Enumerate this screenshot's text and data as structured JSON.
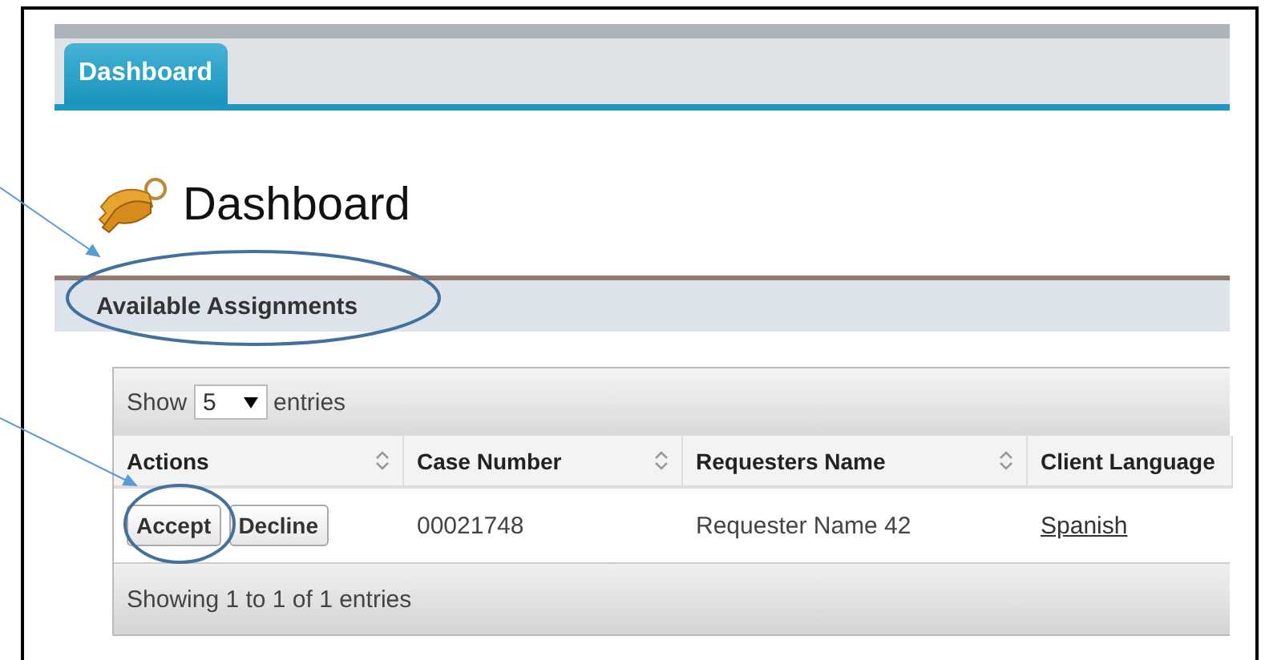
{
  "tabs": [
    {
      "label": "Dashboard",
      "selected": true
    }
  ],
  "page_title": "Dashboard",
  "section_title": "Available Assignments",
  "table": {
    "length_label_before": "Show",
    "length_value": "5",
    "length_label_after": "entries",
    "columns": [
      {
        "label": "Actions",
        "sort_icon": true
      },
      {
        "label": "Case Number",
        "sort_icon": true
      },
      {
        "label": "Requesters Name",
        "sort_icon": true
      },
      {
        "label": "Client Language",
        "sort_icon": false
      }
    ],
    "rows": [
      {
        "actions": [
          "Accept",
          "Decline"
        ],
        "case_number": "00021748",
        "requester_name": "Requester Name 42",
        "client_language": "Spanish"
      }
    ],
    "info": "Showing 1 to 1 of 1 entries"
  }
}
